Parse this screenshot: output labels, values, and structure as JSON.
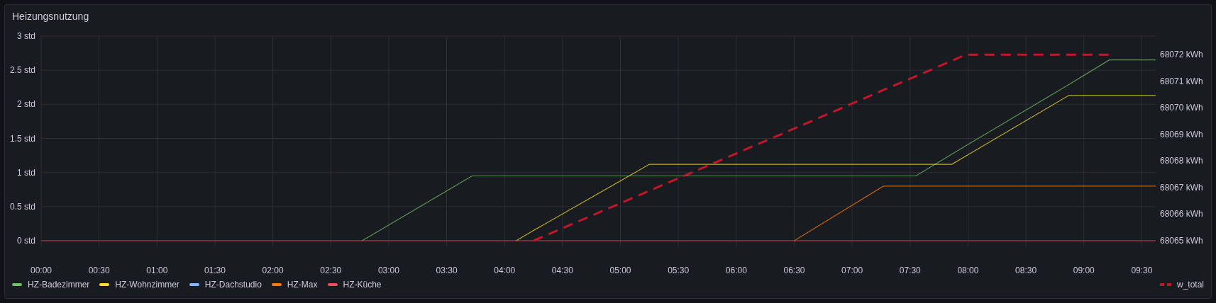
{
  "panel": {
    "title": "Heizungsnutzung",
    "chart_data": {
      "type": "line",
      "x": [
        0,
        2.77,
        3.72,
        4.1,
        4.25,
        5.25,
        6.5,
        7.27,
        7.55,
        7.86,
        7.98,
        8.87,
        9.22,
        9.62
      ],
      "xlim": [
        0,
        9.62
      ],
      "xticks": [
        {
          "value": 0,
          "label": "00:00"
        },
        {
          "value": 0.5,
          "label": "00:30"
        },
        {
          "value": 1,
          "label": "01:00"
        },
        {
          "value": 1.5,
          "label": "01:30"
        },
        {
          "value": 2,
          "label": "02:00"
        },
        {
          "value": 2.5,
          "label": "02:30"
        },
        {
          "value": 3,
          "label": "03:00"
        },
        {
          "value": 3.5,
          "label": "03:30"
        },
        {
          "value": 4,
          "label": "04:00"
        },
        {
          "value": 4.5,
          "label": "04:30"
        },
        {
          "value": 5,
          "label": "05:00"
        },
        {
          "value": 5.5,
          "label": "05:30"
        },
        {
          "value": 6,
          "label": "06:00"
        },
        {
          "value": 6.5,
          "label": "06:30"
        },
        {
          "value": 7,
          "label": "07:00"
        },
        {
          "value": 7.5,
          "label": "07:30"
        },
        {
          "value": 8,
          "label": "08:00"
        },
        {
          "value": 8.5,
          "label": "08:30"
        },
        {
          "value": 9,
          "label": "09:00"
        },
        {
          "value": 9.5,
          "label": "09:30"
        }
      ],
      "ylim": [
        0,
        3
      ],
      "grid": true,
      "yticks": [
        {
          "value": 0,
          "label": "0 std"
        },
        {
          "value": 0.5,
          "label": "0.5 std"
        },
        {
          "value": 1,
          "label": "1 std"
        },
        {
          "value": 1.5,
          "label": "1.5 std"
        },
        {
          "value": 2,
          "label": "2 std"
        },
        {
          "value": 2.5,
          "label": "2.5 std"
        },
        {
          "value": 3,
          "label": "3 std"
        }
      ],
      "y2lim": [
        68065,
        68072.7
      ],
      "y2ticks": [
        {
          "value": 68065,
          "label": "68065 kWh"
        },
        {
          "value": 68066,
          "label": "68066 kWh"
        },
        {
          "value": 68067,
          "label": "68067 kWh"
        },
        {
          "value": 68068,
          "label": "68068 kWh"
        },
        {
          "value": 68069,
          "label": "68069 kWh"
        },
        {
          "value": 68070,
          "label": "68070 kWh"
        },
        {
          "value": 68071,
          "label": "68071 kWh"
        },
        {
          "value": 68072,
          "label": "68072 kWh"
        }
      ],
      "series": [
        {
          "name": "HZ-Badezimmer",
          "color": "#73bf69",
          "line_style": "solid",
          "values": [
            null,
            0,
            0.95,
            0.95,
            0.95,
            0.95,
            0.95,
            0.95,
            0.95,
            1.27,
            1.39,
            2.29,
            2.65,
            2.65
          ]
        },
        {
          "name": "HZ-Wohnzimmer",
          "color": "#fade2a",
          "line_style": "solid",
          "values": [
            null,
            null,
            null,
            0,
            0.15,
            1.12,
            1.12,
            1.12,
            1.12,
            1.12,
            1.24,
            2.13,
            2.13,
            2.13
          ]
        },
        {
          "name": "HZ-Dachstudio",
          "color": "#8ab8ff",
          "values": [
            null,
            null,
            null,
            null,
            null,
            null,
            null,
            null,
            null,
            null,
            null,
            null,
            null,
            null
          ]
        },
        {
          "name": "HZ-Max",
          "color": "#ff780a",
          "line_style": "solid",
          "values": [
            null,
            null,
            null,
            null,
            null,
            null,
            0,
            0.8,
            0.8,
            0.8,
            0.8,
            0.8,
            0.8,
            0.8
          ]
        },
        {
          "name": "HZ-Küche",
          "color": "#f2495c",
          "line_style": "solid",
          "values": [
            0,
            0,
            0,
            0,
            0,
            0,
            0,
            0,
            0,
            0,
            0,
            0,
            0,
            0
          ]
        },
        {
          "name": "w_total",
          "color": "#c4162a",
          "axis": "y2",
          "line_style": "dashed",
          "values": [
            null,
            null,
            null,
            null,
            68065,
            68066.88,
            68069.22,
            68070.67,
            68071.19,
            68071.77,
            68072,
            68072,
            68072,
            null
          ]
        }
      ]
    }
  }
}
